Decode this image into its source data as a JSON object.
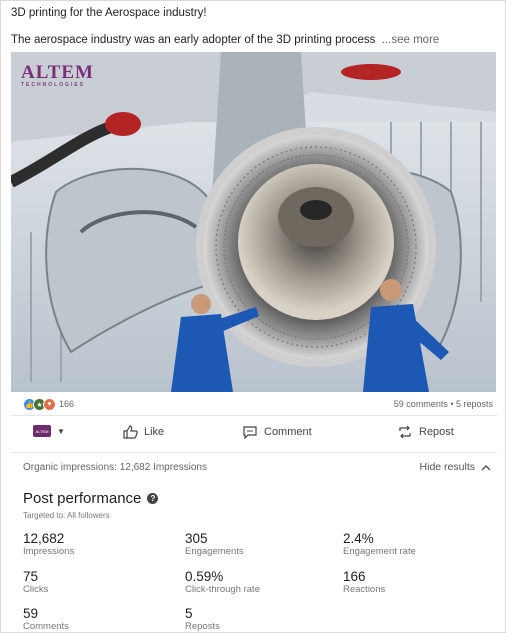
{
  "post": {
    "headline": "3D printing for the Aerospace industry!",
    "body": "The aerospace industry was an early adopter of the 3D printing process",
    "see_more": "...see more",
    "image": {
      "brand_name": "ALTEM",
      "brand_tagline": "TECHNOLOGIES",
      "icon": "jet-engine-with-technicians-photo"
    }
  },
  "social": {
    "reactions_count": "166",
    "comments_reposts": "59 comments • 5 reposts"
  },
  "actions": {
    "actor_label": "ALTEM",
    "like": "Like",
    "comment": "Comment",
    "repost": "Repost"
  },
  "analytics": {
    "organic_impressions": "Organic impressions: 12,682 Impressions",
    "hide_results": "Hide results",
    "title": "Post performance",
    "targeted": "Targeted to: All followers",
    "metrics": [
      {
        "value": "12,682",
        "label": "Impressions"
      },
      {
        "value": "305",
        "label": "Engagements"
      },
      {
        "value": "2.4%",
        "label": "Engagement rate"
      },
      {
        "value": "75",
        "label": "Clicks"
      },
      {
        "value": "0.59%",
        "label": "Click-through rate"
      },
      {
        "value": "166",
        "label": "Reactions"
      },
      {
        "value": "59",
        "label": "Comments"
      },
      {
        "value": "5",
        "label": "Reposts"
      }
    ]
  },
  "colors": {
    "brand_purple": "#7a2f7a",
    "like_blue": "#378fe9",
    "love_red": "#df704d",
    "celebrate_green": "#44712e"
  }
}
